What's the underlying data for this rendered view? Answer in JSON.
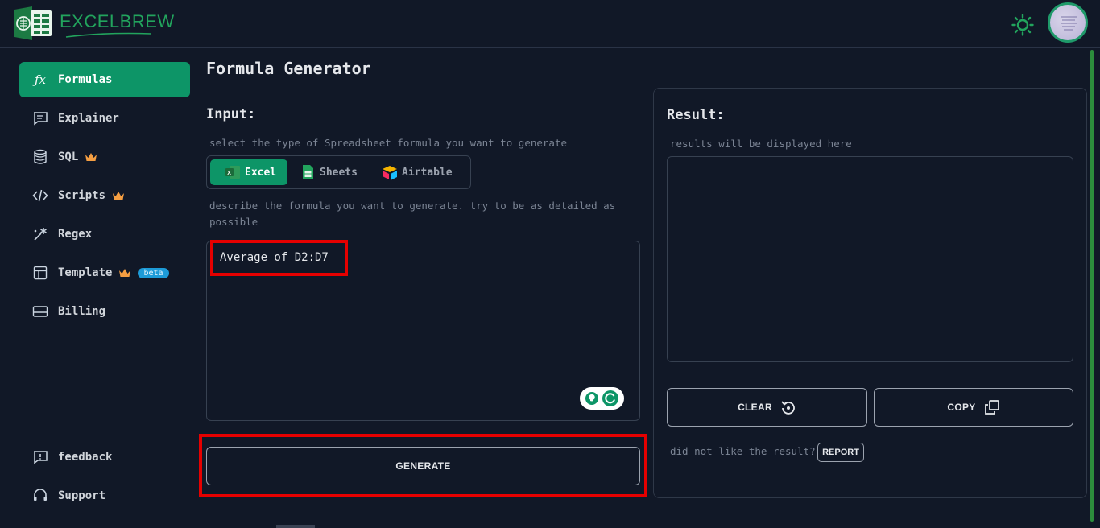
{
  "header": {
    "logo_text": "EXCELBREW",
    "theme_icon": "sun-icon",
    "avatar_icon": "user-avatar"
  },
  "sidebar": {
    "items": [
      {
        "label": "Formulas",
        "icon": "function-icon",
        "active": true
      },
      {
        "label": "Explainer",
        "icon": "chat-icon"
      },
      {
        "label": "SQL",
        "icon": "database-icon",
        "premium": true
      },
      {
        "label": "Scripts",
        "icon": "code-icon",
        "premium": true
      },
      {
        "label": "Regex",
        "icon": "regex-icon"
      },
      {
        "label": "Template",
        "icon": "table-icon",
        "premium": true,
        "badge": "beta"
      },
      {
        "label": "Billing",
        "icon": "card-icon"
      }
    ],
    "bottom": [
      {
        "label": "feedback",
        "icon": "feedback-icon"
      },
      {
        "label": "Support",
        "icon": "headset-icon"
      }
    ]
  },
  "main": {
    "title": "Formula Generator",
    "input_label": "Input:",
    "type_hint": "select the type of Spreadsheet formula you want to generate",
    "types": [
      {
        "label": "Excel",
        "active": true
      },
      {
        "label": "Sheets"
      },
      {
        "label": "Airtable"
      }
    ],
    "describe_hint_1": "describe the formula you want to generate. try to be as detailed as",
    "describe_hint_2": "possible",
    "prompt_value": "Average of D2:D7",
    "generate_label": "GENERATE"
  },
  "result": {
    "label": "Result:",
    "placeholder": "results will be displayed here",
    "clear_label": "CLEAR",
    "copy_label": "COPY",
    "feedback_text": "did not like the result?",
    "report_label": "REPORT"
  },
  "colors": {
    "accent": "#0d9567",
    "brand": "#22a45d",
    "background": "#111827",
    "highlight": "#e60000",
    "beta_badge": "#1d9bd8",
    "crown": "#f59e42"
  }
}
